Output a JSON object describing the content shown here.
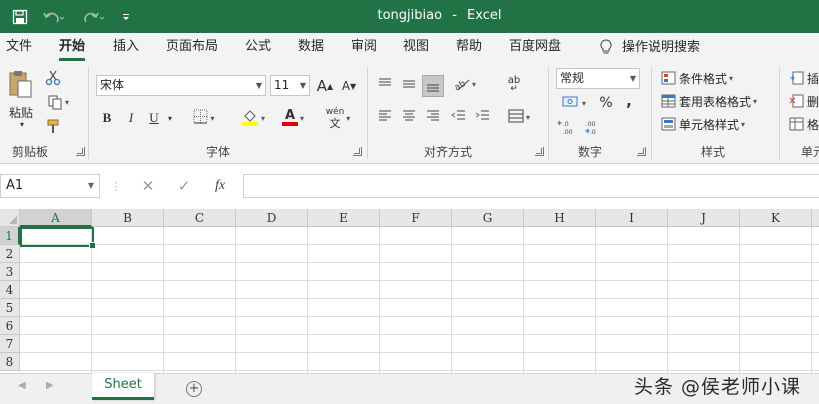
{
  "titlebar": {
    "document_name": "tongjibiao",
    "separator": "-",
    "app_name": "Excel",
    "icons": [
      "save-icon",
      "undo-icon",
      "redo-icon",
      "customize-qat-icon"
    ],
    "accent_color": "#217346"
  },
  "tabs": [
    {
      "label": "文件"
    },
    {
      "label": "开始",
      "active": true
    },
    {
      "label": "插入"
    },
    {
      "label": "页面布局"
    },
    {
      "label": "公式"
    },
    {
      "label": "数据"
    },
    {
      "label": "审阅"
    },
    {
      "label": "视图"
    },
    {
      "label": "帮助"
    },
    {
      "label": "百度网盘"
    }
  ],
  "tell_me": {
    "label": "操作说明搜索",
    "icon": "lightbulb-icon"
  },
  "ribbon": {
    "clipboard": {
      "paste_label": "粘贴",
      "group_label": "剪贴板"
    },
    "font": {
      "font_name": "宋体",
      "font_size": "11",
      "grow_label": "A",
      "shrink_label": "A",
      "bold": "B",
      "italic": "I",
      "underline": "U",
      "font_color_glyph": "A",
      "phonetic_top": "wén",
      "phonetic_bottom": "文",
      "group_label": "字体"
    },
    "alignment": {
      "wrap_glyph": "ab",
      "group_label": "对齐方式"
    },
    "number": {
      "format": "常规",
      "percent": "%",
      "comma": ",",
      "inc_decimal": "←.0\n.00",
      "dec_decimal": ".00\n→.0",
      "group_label": "数字"
    },
    "styles": {
      "conditional": "条件格式",
      "table": "套用表格格式",
      "cell": "单元格样式",
      "group_label": "样式"
    },
    "cells": {
      "insert": "插",
      "delete": "删",
      "format": "格",
      "group_label": "单元"
    }
  },
  "formula_bar": {
    "name_box": "A1",
    "cancel": "✕",
    "enter": "✓",
    "fx": "fx",
    "value": ""
  },
  "grid": {
    "columns": [
      "A",
      "B",
      "C",
      "D",
      "E",
      "F",
      "G",
      "H",
      "I",
      "J",
      "K"
    ],
    "rows": [
      "1",
      "2",
      "3",
      "4",
      "5",
      "6",
      "7",
      "8"
    ],
    "active_cell": "A1"
  },
  "sheets": [
    {
      "name": "Sheet",
      "active": true
    }
  ],
  "add_sheet": "+",
  "watermark": "头条 @侯老师小课"
}
